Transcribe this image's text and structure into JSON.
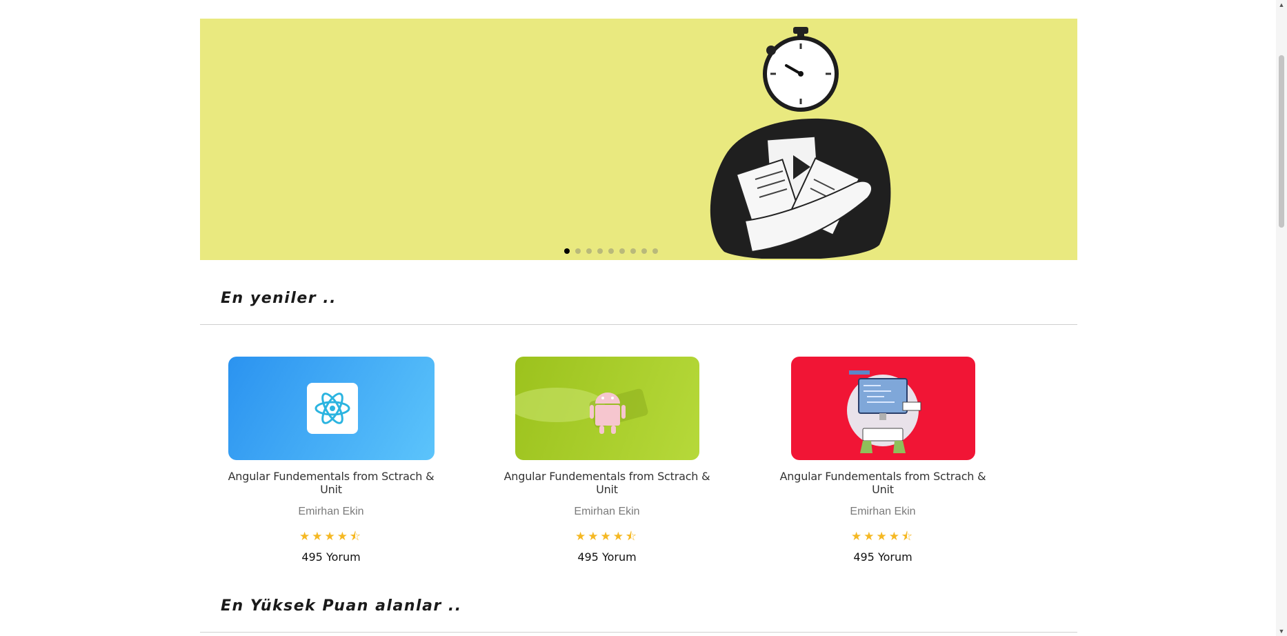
{
  "hero": {
    "slide_count": 9,
    "active_slide": 0,
    "background": "#e9e97f"
  },
  "sections": {
    "newest_title": "En yeniler ..",
    "top_rated_title": "En Yüksek Puan alanlar .."
  },
  "courses": [
    {
      "title": "Angular Fundementals from Sctrach & Unit",
      "author": "Emirhan Ekin",
      "rating": 4.5,
      "stars_text": "★★★★⯪",
      "reviews": "495 Yorum",
      "thumbnail_icon": "react-icon",
      "thumbnail_color": "#3aa3f5"
    },
    {
      "title": "Angular Fundementals from Sctrach & Unit",
      "author": "Emirhan Ekin",
      "rating": 4.5,
      "stars_text": "★★★★⯪",
      "reviews": "495 Yorum",
      "thumbnail_icon": "android-icon",
      "thumbnail_color": "#a9cc2c"
    },
    {
      "title": "Angular Fundementals from Sctrach & Unit",
      "author": "Emirhan Ekin",
      "rating": 4.5,
      "stars_text": "★★★★⯪",
      "reviews": "495 Yorum",
      "thumbnail_icon": "computer-coding-icon",
      "thumbnail_color": "#f11535"
    }
  ],
  "colors": {
    "star": "#f5b823",
    "divider": "#cfcfcf"
  }
}
